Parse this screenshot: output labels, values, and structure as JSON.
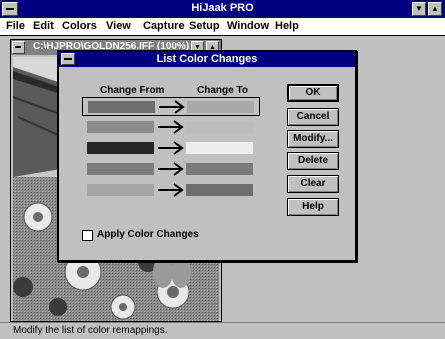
{
  "app": {
    "title": "HiJaak PRO"
  },
  "menu": [
    "File",
    "Edit",
    "Colors",
    "View",
    "Capture",
    "Setup",
    "Window",
    "Help"
  ],
  "child_window": {
    "title": "C:\\HJPRO\\GOLDN256.IFF (100%)"
  },
  "dialog": {
    "title": "List Color Changes",
    "change_from_label": "Change From",
    "change_to_label": "Change To",
    "rows": [
      {
        "from_color": "#7a7a7a",
        "to_color": "#a9a9a9",
        "selected": true
      },
      {
        "from_color": "#9a9a9a",
        "to_color": "#bdbdbd",
        "selected": false
      },
      {
        "from_color": "#2a2a2a",
        "to_color": "#eeeeee",
        "selected": false
      },
      {
        "from_color": "#8a8a8a",
        "to_color": "#7b7b7b",
        "selected": false
      },
      {
        "from_color": "#b5b5b5",
        "to_color": "#6e6e6e",
        "selected": false
      }
    ],
    "buttons": {
      "ok": "OK",
      "cancel": "Cancel",
      "modify": "Modify...",
      "delete": "Delete",
      "clear": "Clear",
      "help": "Help"
    },
    "apply_label": "Apply Color Changes",
    "apply_checked": false
  },
  "status": {
    "text": "Modify the list of color remappings."
  }
}
